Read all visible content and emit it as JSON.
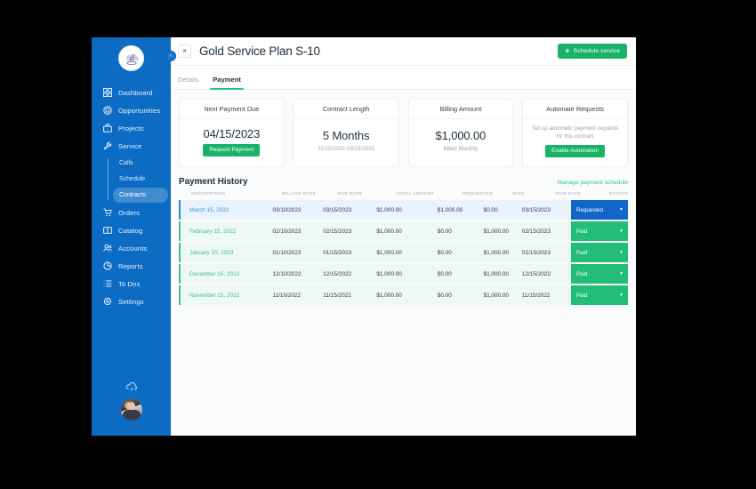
{
  "brand": {
    "sidebar_color": "#0c6cc4",
    "accent_green": "#19b368",
    "accent_blue": "#1266c8",
    "logo_name": "d-cloud-logo"
  },
  "sidebar": {
    "collapse_label": "‹",
    "items": [
      {
        "label": "Dashboard",
        "icon": "grid-icon"
      },
      {
        "label": "Opportunities",
        "icon": "target-icon"
      },
      {
        "label": "Projects",
        "icon": "briefcase-icon"
      },
      {
        "label": "Service",
        "icon": "wrench-icon"
      },
      {
        "label": "Orders",
        "icon": "cart-icon"
      },
      {
        "label": "Catalog",
        "icon": "book-icon"
      },
      {
        "label": "Accounts",
        "icon": "people-icon"
      },
      {
        "label": "Reports",
        "icon": "pie-chart-icon"
      },
      {
        "label": "To Dos",
        "icon": "list-icon"
      },
      {
        "label": "Settings",
        "icon": "gear-icon"
      }
    ],
    "service_subitems": [
      {
        "label": "Calls",
        "active": false
      },
      {
        "label": "Schedule",
        "active": false
      },
      {
        "label": "Contracts",
        "active": true
      }
    ],
    "cloud_icon": "cloud-upload-icon",
    "avatar": "user-avatar"
  },
  "topbar": {
    "close_label": "×",
    "title": "Gold Service Plan S-10",
    "schedule_button": "Schedule service",
    "schedule_plus": "+"
  },
  "tabs": [
    {
      "label": "Details",
      "active": false
    },
    {
      "label": "Payment",
      "active": true
    }
  ],
  "cards": [
    {
      "title": "Next Payment Due",
      "value": "04/15/2023",
      "button": "Request Payment",
      "sub": ""
    },
    {
      "title": "Contract Length",
      "value": "5 Months",
      "sub": "11/15/2022-03/15/2023",
      "button": ""
    },
    {
      "title": "Billing Amount",
      "value": "$1,000.00",
      "sub": "Billed Monthly",
      "button": ""
    },
    {
      "title": "Automate Requests",
      "value": "",
      "sub": "Set up automatic payment requests for this contract",
      "button": "Enable Automation"
    }
  ],
  "payment_history": {
    "title": "Payment History",
    "manage_link": "Manage payment schedule",
    "columns": [
      "DESCRIPTION",
      "BILLING DATE",
      "DUE DATE",
      "TOTAL AMOUNT",
      "REQUESTED",
      "PAID",
      "PAID DATE",
      "STATUS"
    ],
    "rows": [
      {
        "description": "March 15, 2022",
        "billing_date": "03/10/2023",
        "due_date": "03/15/2023",
        "total_amount": "$1,000.00",
        "requested": "$1,000.00",
        "paid": "$0.00",
        "paid_date": "03/15/2023",
        "status": "Requested",
        "state": "requested"
      },
      {
        "description": "February 15, 2022",
        "billing_date": "02/10/2023",
        "due_date": "02/15/2023",
        "total_amount": "$1,000.00",
        "requested": "$0.00",
        "paid": "$1,000.00",
        "paid_date": "02/15/2023",
        "status": "Paid",
        "state": "paid"
      },
      {
        "description": "January 15, 2023",
        "billing_date": "01/10/2023",
        "due_date": "01/15/2023",
        "total_amount": "$1,000.00",
        "requested": "$0.00",
        "paid": "$1,000.00",
        "paid_date": "01/15/2023",
        "status": "Paid",
        "state": "paid"
      },
      {
        "description": "December 15, 2022",
        "billing_date": "12/10/2022",
        "due_date": "12/15/2022",
        "total_amount": "$1,000.00",
        "requested": "$0.00",
        "paid": "$1,000.00",
        "paid_date": "12/15/2022",
        "status": "Paid",
        "state": "paid"
      },
      {
        "description": "November 15, 2022",
        "billing_date": "11/10/2022",
        "due_date": "11/15/2022",
        "total_amount": "$1,000.00",
        "requested": "$0.00",
        "paid": "$1,000.00",
        "paid_date": "11/15/2022",
        "status": "Paid",
        "state": "paid"
      }
    ],
    "caret": "▼"
  }
}
